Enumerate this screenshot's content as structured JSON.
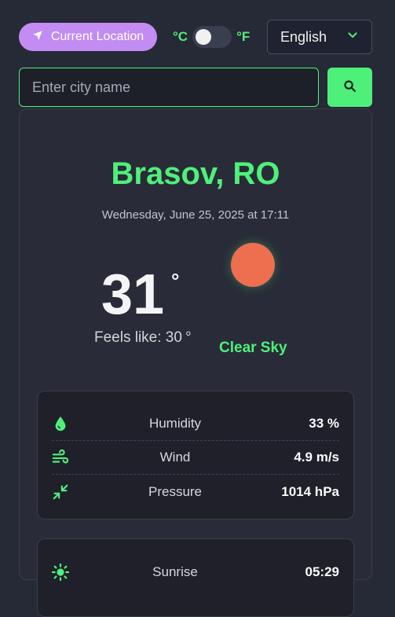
{
  "header": {
    "location_button_label": "Current Location",
    "unit_celsius": "°C",
    "unit_fahrenheit": "°F",
    "language": "English"
  },
  "search": {
    "placeholder": "Enter city name",
    "value": ""
  },
  "weather": {
    "city": "Brasov, RO",
    "datetime": "Wednesday, June 25, 2025 at 17:11",
    "temperature": "31",
    "degree_symbol": "°",
    "feels_like_label": "Feels like: 30",
    "feels_like_unit": "°",
    "condition": "Clear Sky"
  },
  "details": [
    {
      "label": "Humidity",
      "value": "33 %",
      "icon": "droplet-icon"
    },
    {
      "label": "Wind",
      "value": "4.9 m/s",
      "icon": "wind-icon"
    },
    {
      "label": "Pressure",
      "value": "1014 hPa",
      "icon": "compress-icon"
    }
  ],
  "sun_details": [
    {
      "label": "Sunrise",
      "value": "05:29",
      "icon": "sunrise-icon"
    }
  ],
  "colors": {
    "accent": "#4ff07a",
    "location_button": "#c28cf2",
    "background": "#262936",
    "sun": "#ee6e50"
  }
}
